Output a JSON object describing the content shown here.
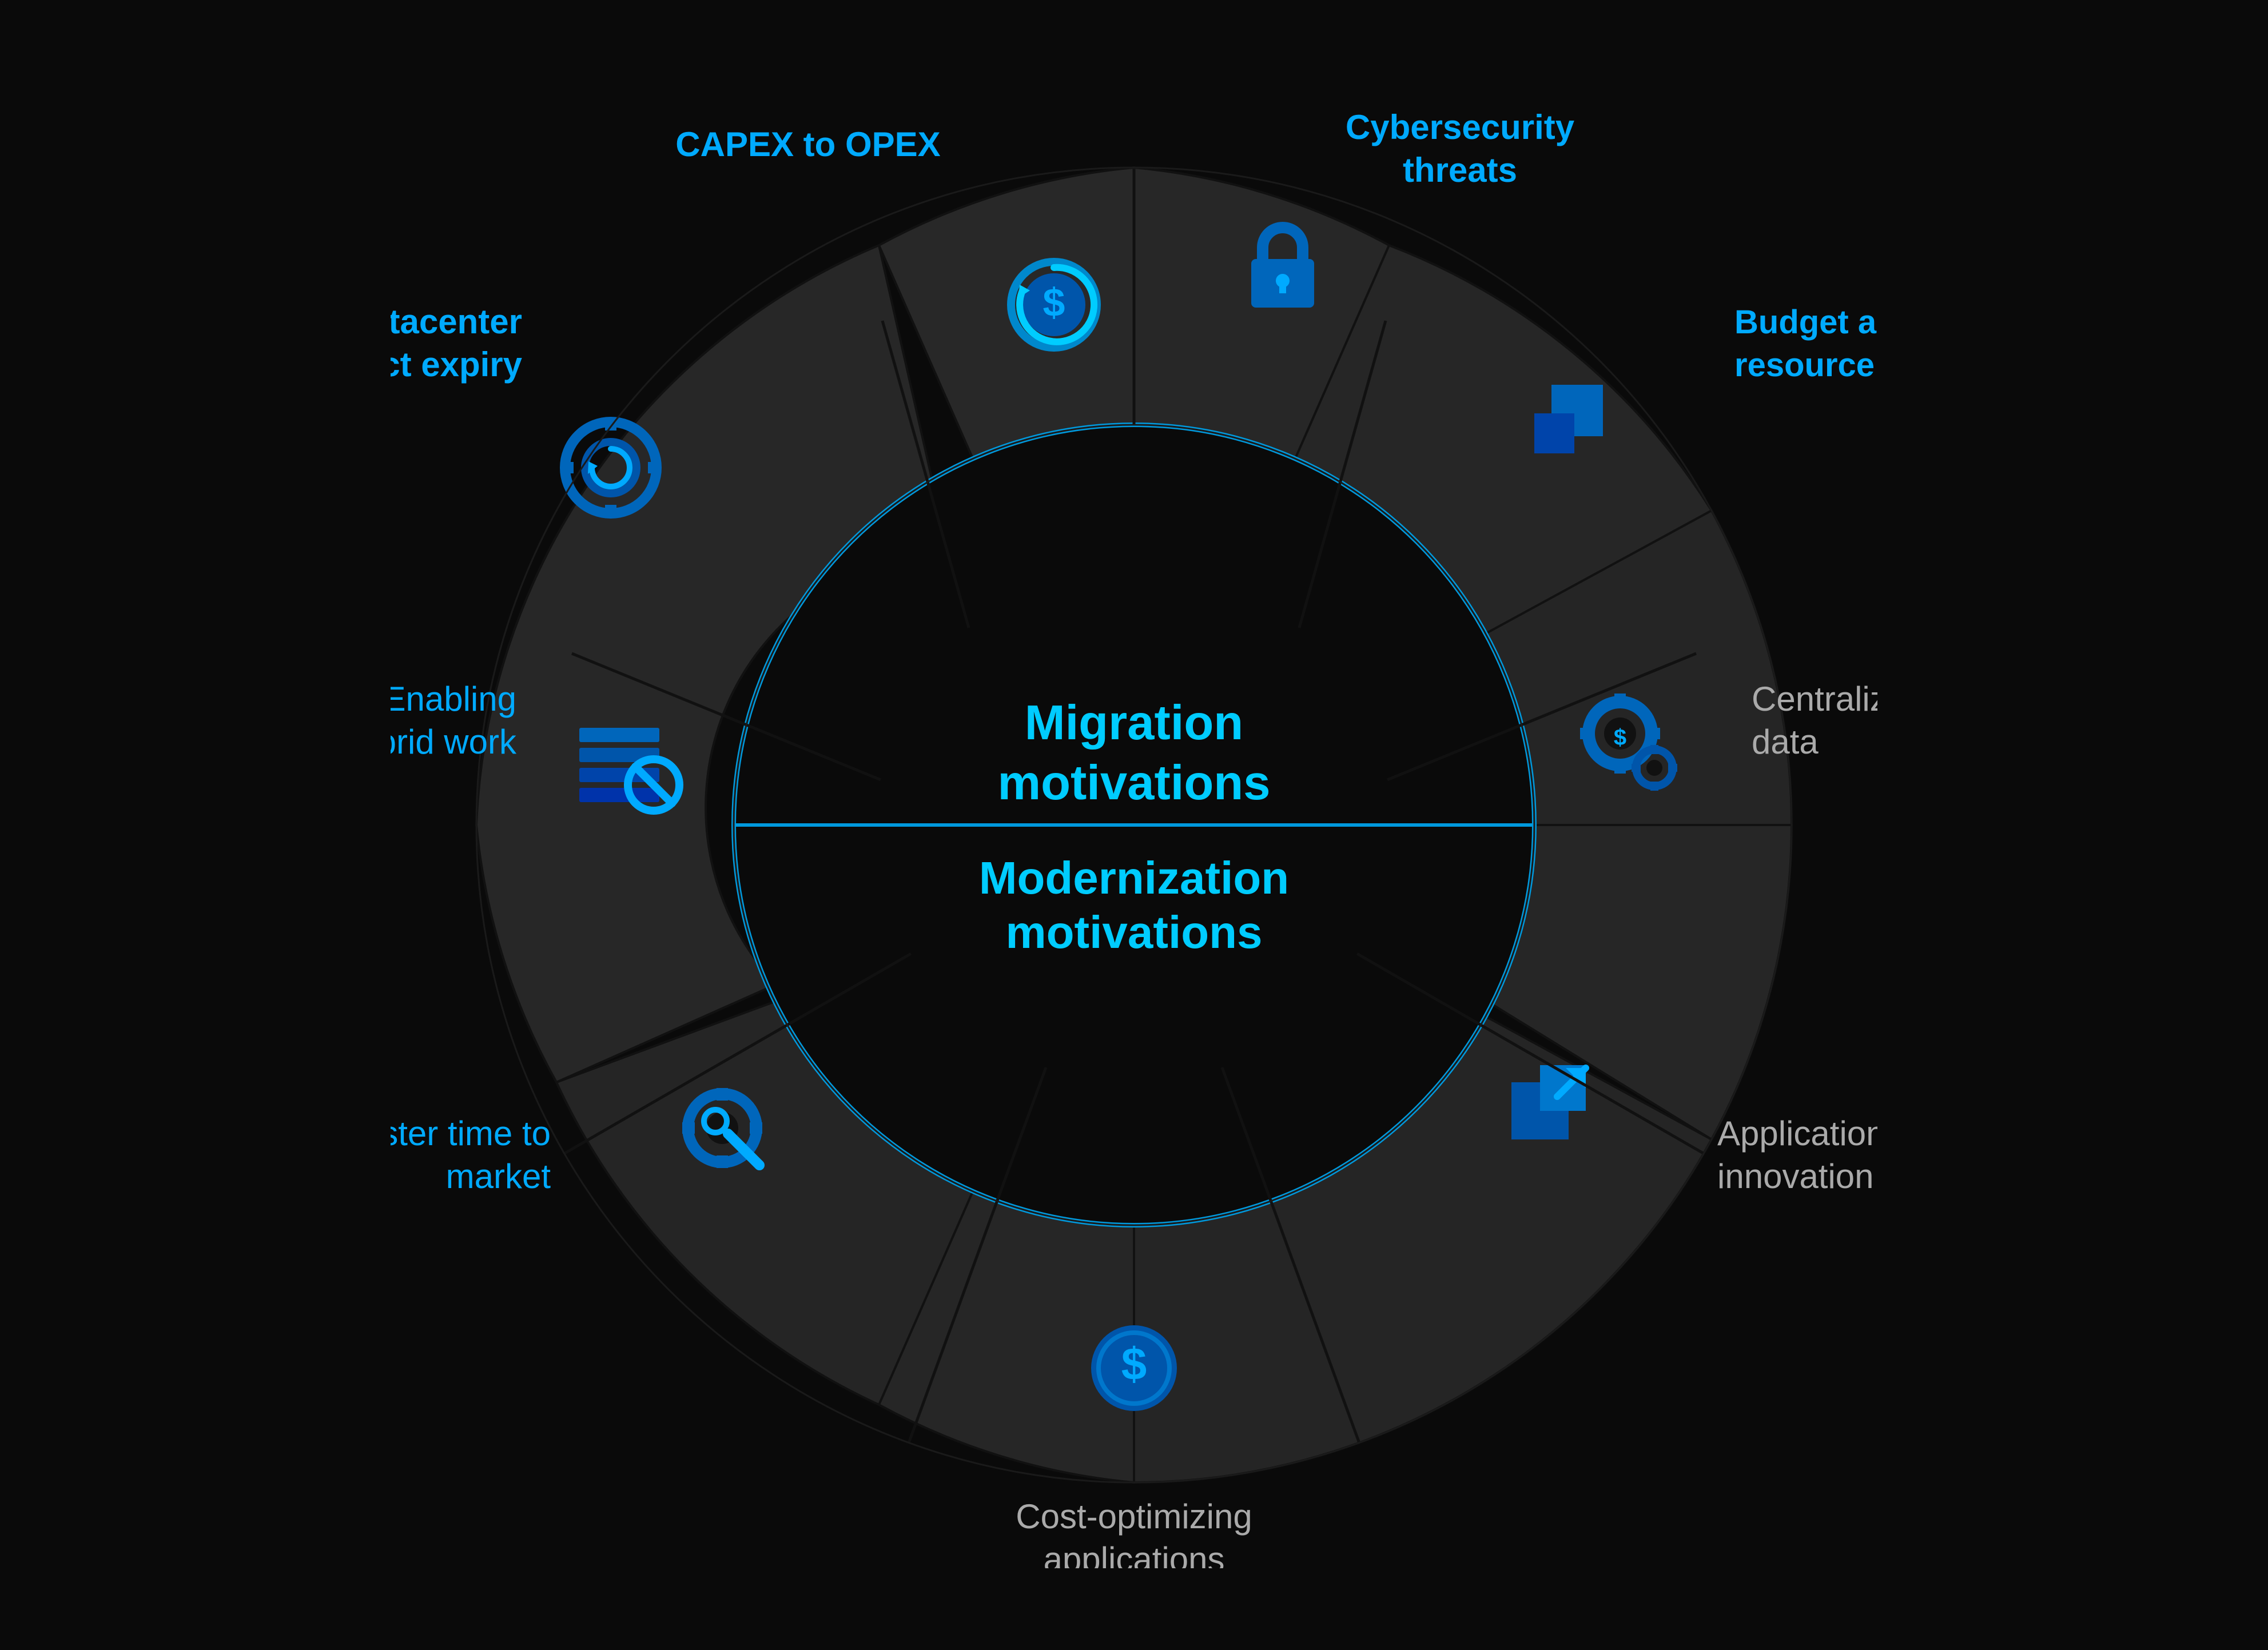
{
  "diagram": {
    "title_migration": "Migration\nmotivations",
    "title_modernization": "Modernization\nmotivations",
    "segments": [
      {
        "id": "capex",
        "label": "CAPEX to OPEX",
        "icon": "dollar-circle",
        "type": "migration"
      },
      {
        "id": "cyber",
        "label": "Cybersecurity\nthreats",
        "icon": "lock",
        "type": "migration"
      },
      {
        "id": "budget",
        "label": "Budget and\nresource constraints",
        "icon": "budget-square",
        "type": "migration"
      },
      {
        "id": "centralizing",
        "label": "Centralizing\ndata",
        "icon": "gear-dollar",
        "type": "modernization"
      },
      {
        "id": "application",
        "label": "Application\ninnovation",
        "icon": "app-arrow",
        "type": "modernization"
      },
      {
        "id": "cost",
        "label": "Cost-optimizing\napplications",
        "icon": "dollar-coin",
        "type": "modernization"
      },
      {
        "id": "faster",
        "label": "Faster time to\nmarket",
        "icon": "gear-wrench",
        "type": "modernization"
      },
      {
        "id": "hybrid",
        "label": "Enabling\nhybrid work",
        "icon": "layers-cancel",
        "type": "modernization"
      },
      {
        "id": "datacenter",
        "label": "Datacenter\ncontract expiry",
        "icon": "gear-circle",
        "type": "migration"
      }
    ],
    "colors": {
      "background": "#111111",
      "segment_migration": "#2a2a2a",
      "segment_modernization": "#222222",
      "accent": "#0099dd",
      "accent_bright": "#00ccff",
      "text_accent": "#00aaff",
      "text_light": "#bbbbbb",
      "center_bg": "#050505",
      "divider": "#0088cc"
    }
  }
}
